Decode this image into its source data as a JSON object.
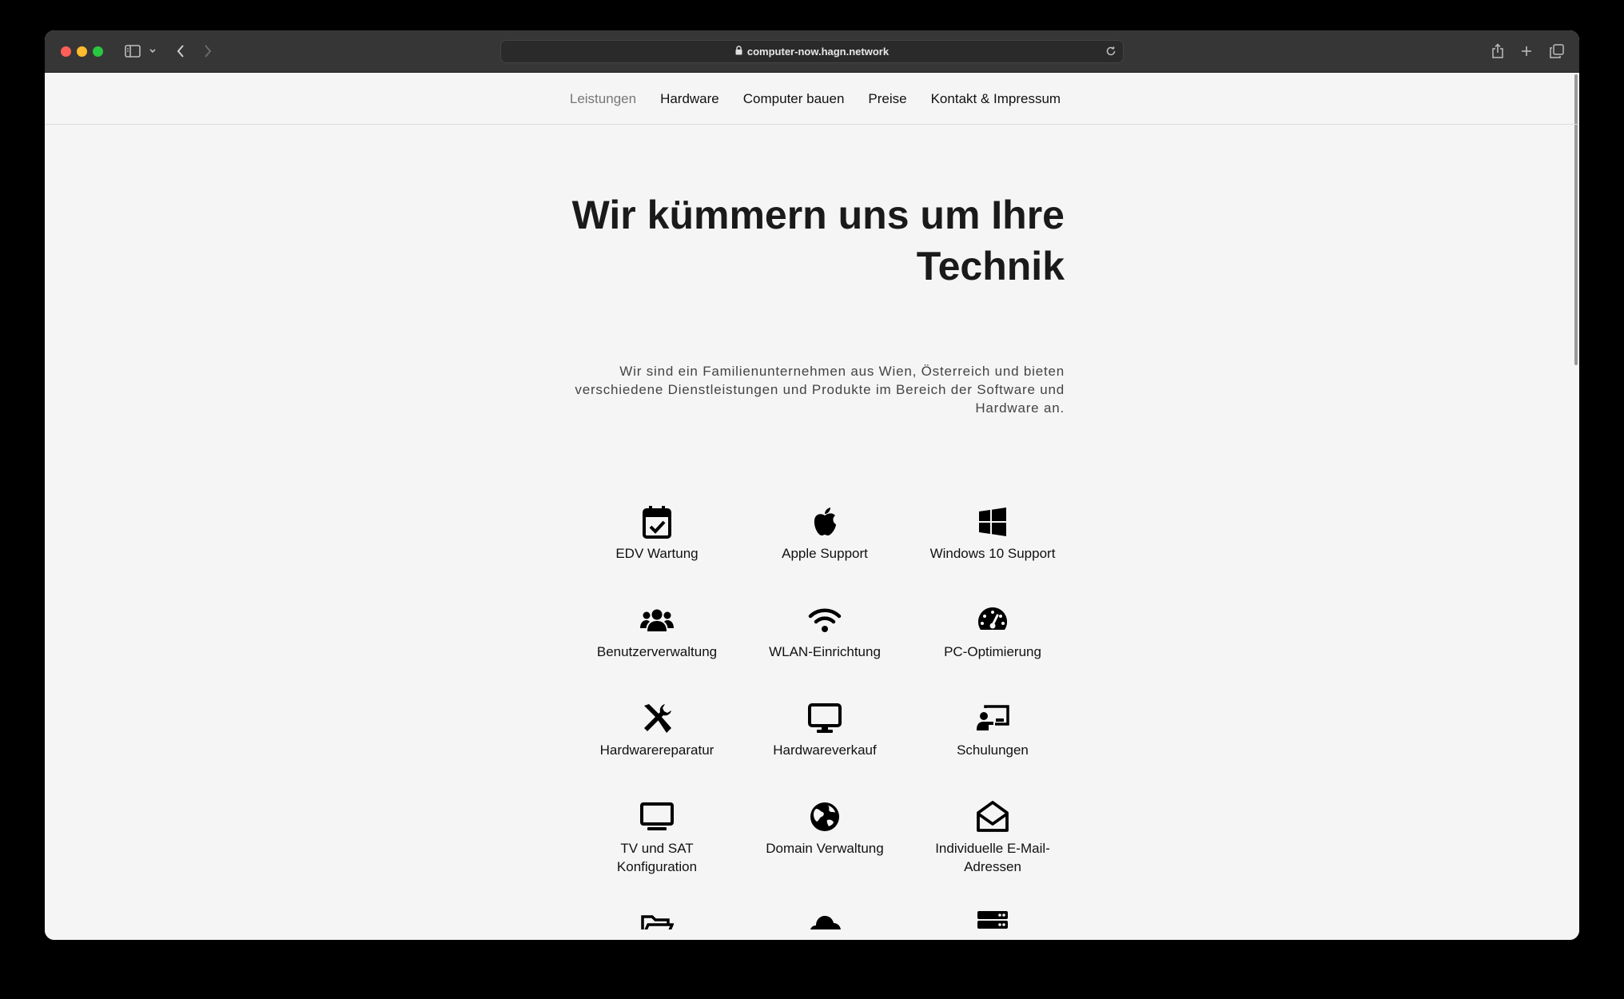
{
  "browser": {
    "url": "computer-now.hagn.network"
  },
  "nav": {
    "items": [
      {
        "label": "Leistungen"
      },
      {
        "label": "Hardware"
      },
      {
        "label": "Computer bauen"
      },
      {
        "label": "Preise"
      },
      {
        "label": "Kontakt & Impressum"
      }
    ]
  },
  "hero": {
    "title_line1": "Wir kümmern uns um Ihre",
    "title_line2": "Technik",
    "description": "Wir sind ein Familienunternehmen aus Wien, Österreich und bieten verschiedene Dienstleistungen und Produkte im Bereich der Software und Hardware an."
  },
  "services": [
    {
      "label": "EDV Wartung",
      "icon": "calendar-check-icon"
    },
    {
      "label": "Apple Support",
      "icon": "apple-icon"
    },
    {
      "label": "Windows 10 Support",
      "icon": "windows-icon"
    },
    {
      "label": "Benutzerverwaltung",
      "icon": "users-icon"
    },
    {
      "label": "WLAN-Einrichtung",
      "icon": "wifi-icon"
    },
    {
      "label": "PC-Optimierung",
      "icon": "speedometer-icon"
    },
    {
      "label": "Hardwarereparatur",
      "icon": "tools-icon"
    },
    {
      "label": "Hardwareverkauf",
      "icon": "monitor-icon"
    },
    {
      "label": "Schulungen",
      "icon": "teacher-icon"
    },
    {
      "label": "TV und SAT Konfiguration",
      "icon": "tv-icon"
    },
    {
      "label": "Domain Verwaltung",
      "icon": "globe-icon"
    },
    {
      "label": "Individuelle E-Mail-Adressen",
      "icon": "envelope-open-icon"
    }
  ]
}
